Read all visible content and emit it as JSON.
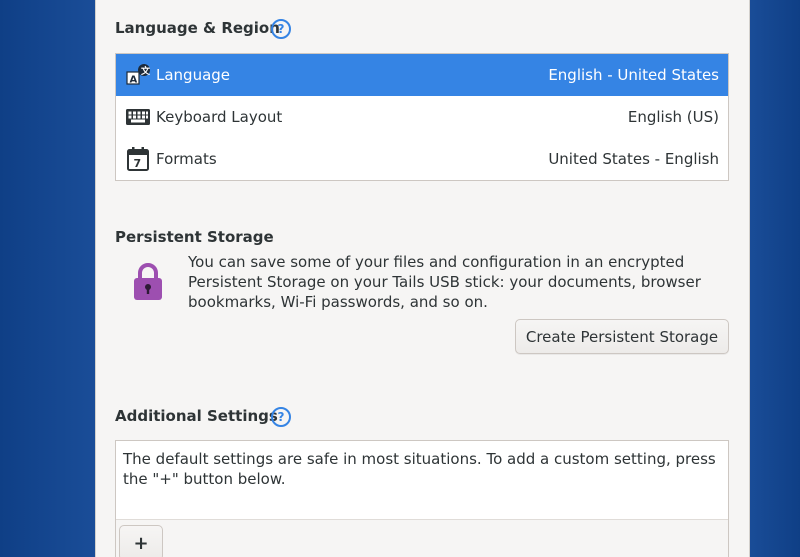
{
  "language_region": {
    "title": "Language & Region",
    "help_label": "?",
    "rows": [
      {
        "label": "Language",
        "value": "English - United States",
        "icon": "language-icon"
      },
      {
        "label": "Keyboard Layout",
        "value": "English (US)",
        "icon": "keyboard-icon"
      },
      {
        "label": "Formats",
        "value": "United States - English",
        "icon": "calendar-icon"
      }
    ]
  },
  "persistent_storage": {
    "title": "Persistent Storage",
    "description": "You can save some of your files and configuration in an encrypted Persistent Storage on your Tails USB stick: your documents, browser bookmarks, Wi-Fi passwords, and so on.",
    "button_label": "Create Persistent Storage",
    "icon": "lock-icon"
  },
  "additional_settings": {
    "title": "Additional Settings",
    "help_label": "?",
    "description": "The default settings are safe in most situations. To add a custom setting, press the \"+\" button below.",
    "add_label": "+"
  },
  "colors": {
    "accent": "#3584e4",
    "background": "#1e4e97",
    "panel": "#f6f5f4",
    "lock": "#9d4fb0"
  }
}
